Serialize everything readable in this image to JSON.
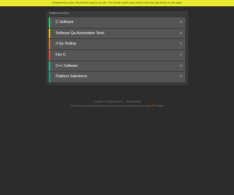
{
  "banner": {
    "text": "Transparency notice: this domain may be for sale. The domain owner may receive a fee from ads shown on this page.",
    "color": "#e8ec2c"
  },
  "panel": {
    "heading": "Related searches",
    "items": [
      {
        "label": "C Software",
        "accent": "#2ecc71",
        "icon": "chevron-right-icon"
      },
      {
        "label": "Software Qa Automation Tools",
        "accent": "#f1c40f",
        "icon": "chevron-right-icon"
      },
      {
        "label": "It Qa Testing",
        "accent": "#e67e22",
        "icon": "chevron-right-icon"
      },
      {
        "label": "Dev C",
        "accent": "#e74c3c",
        "icon": "chevron-right-icon"
      },
      {
        "label": "C++ Software",
        "accent": "#1abc9c",
        "icon": "chevron-right-icon"
      },
      {
        "label": "Platform Salesforce",
        "accent": "#16a085",
        "icon": "chevron-right-icon"
      }
    ]
  },
  "footer": {
    "copyright": "Copyright © All rights reserved",
    "privacy": "Privacy Policy",
    "notice_prefix": "The Sponsored Listings displayed above are served automatically by a third party.",
    "brand": "PK",
    "notice_suffix": "Contact"
  }
}
